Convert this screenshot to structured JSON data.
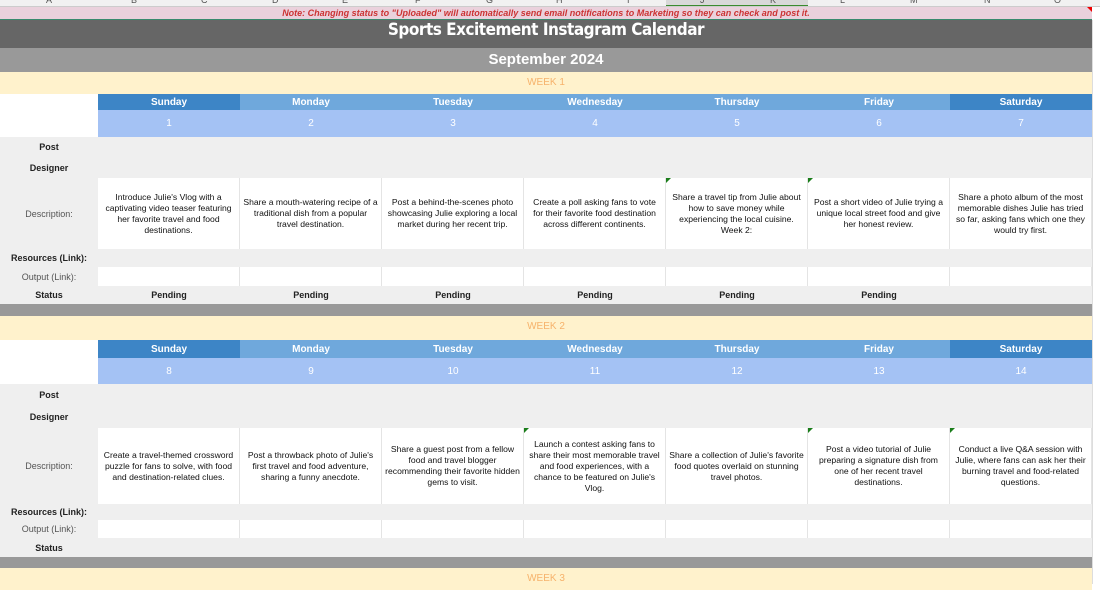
{
  "column_headers": [
    "A",
    "B",
    "C",
    "D",
    "E",
    "F",
    "G",
    "H",
    "I",
    "J",
    "K",
    "L",
    "M",
    "N",
    "O"
  ],
  "note": "Note: Changing status to \"Uploaded\" will automatically send email notifications to Marketing so they can check and post it.",
  "title": "Sports Excitement Instagram Calendar",
  "month": "September 2024",
  "days": [
    "Sunday",
    "Monday",
    "Tuesday",
    "Wednesday",
    "Thursday",
    "Friday",
    "Saturday"
  ],
  "labels": {
    "post": "Post",
    "designer": "Designer",
    "description": "Description:",
    "resources": "Resources (Link):",
    "output": "Output (Link):",
    "status": "Status"
  },
  "weeks": [
    {
      "label": "WEEK 1",
      "dates": [
        "1",
        "2",
        "3",
        "4",
        "5",
        "6",
        "7"
      ],
      "descriptions": [
        "Introduce Julie's Vlog with a captivating video teaser featuring her favorite travel and food destinations.",
        "Share a mouth-watering recipe of a traditional dish from a popular travel destination.",
        "Post a behind-the-scenes photo showcasing Julie exploring a local market during her recent trip.",
        "Create a poll asking fans to vote for their favorite food destination across different continents.",
        "Share a travel tip from Julie about how to save money while experiencing the local cuisine. Week 2:",
        "Post a short video of Julie trying a unique local street food and give her honest review.",
        "Share a photo album of the most memorable dishes Julie has tried so far, asking fans which one they would try first."
      ],
      "statuses": [
        "Pending",
        "Pending",
        "Pending",
        "Pending",
        "Pending",
        "Pending",
        ""
      ]
    },
    {
      "label": "WEEK 2",
      "dates": [
        "8",
        "9",
        "10",
        "11",
        "12",
        "13",
        "14"
      ],
      "descriptions": [
        "Create a travel-themed crossword puzzle for fans to solve, with food and destination-related clues.",
        "Post a throwback photo of Julie's first travel and food adventure, sharing a funny anecdote.",
        "Share a guest post from a fellow food and travel blogger recommending their favorite hidden gems to visit.",
        "Launch a contest asking fans to share their most memorable travel and food experiences, with a chance to be featured on Julie's Vlog.",
        "Share a collection of Julie's favorite food quotes overlaid on stunning travel photos.",
        "Post a video tutorial of Julie preparing a signature dish from one of her recent travel destinations.",
        "Conduct a live Q&A session with Julie, where fans can ask her their burning travel and food-related questions."
      ],
      "statuses": [
        "",
        "",
        "",
        "",
        "",
        "",
        ""
      ]
    },
    {
      "label": "WEEK 3"
    }
  ]
}
